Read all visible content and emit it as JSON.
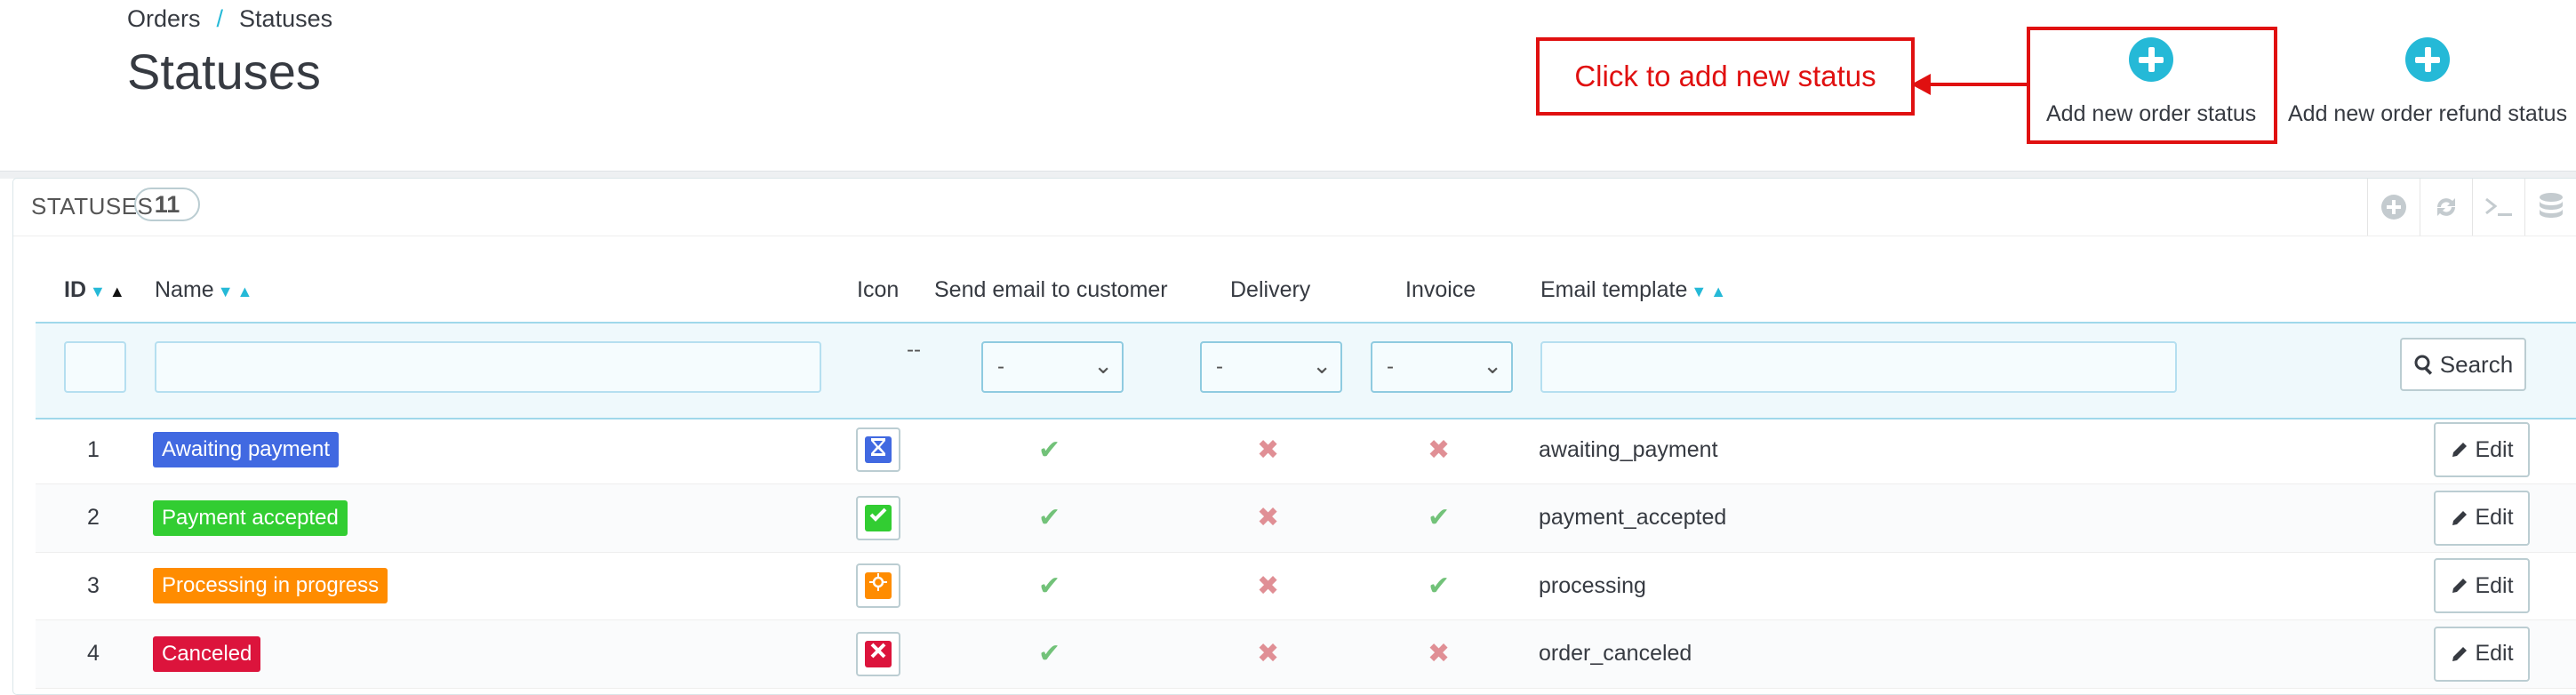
{
  "breadcrumb": {
    "parent": "Orders",
    "separator": "/",
    "current": "Statuses"
  },
  "page_title": "Statuses",
  "callout_text": "Click to add new status",
  "toolbar": {
    "add_order_status": "Add new order status",
    "add_refund_status": "Add new order refund status"
  },
  "panel": {
    "title": "STATUSES",
    "count": "11",
    "heading_icons": [
      "add-icon",
      "refresh-icon",
      "sql-query-icon",
      "database-icon"
    ]
  },
  "table": {
    "columns": {
      "id": "ID",
      "name": "Name",
      "icon": "Icon",
      "send_email": "Send email to customer",
      "delivery": "Delivery",
      "invoice": "Invoice",
      "email_template": "Email template"
    },
    "filters": {
      "icon_placeholder": "--",
      "send_email": "-",
      "delivery": "-",
      "invoice": "-",
      "search_label": "Search"
    },
    "rows": [
      {
        "id": "1",
        "name": "Awaiting payment",
        "color": "#4169e1",
        "icon": "hourglass-icon",
        "send_email": true,
        "delivery": false,
        "invoice": false,
        "template": "awaiting_payment",
        "edit": "Edit"
      },
      {
        "id": "2",
        "name": "Payment accepted",
        "color": "#32cd32",
        "icon": "check-icon",
        "send_email": true,
        "delivery": false,
        "invoice": true,
        "template": "payment_accepted",
        "edit": "Edit"
      },
      {
        "id": "3",
        "name": "Processing in progress",
        "color": "#ff8c00",
        "icon": "gear-icon",
        "send_email": true,
        "delivery": false,
        "invoice": true,
        "template": "processing",
        "edit": "Edit"
      },
      {
        "id": "4",
        "name": "Canceled",
        "color": "#dc143c",
        "icon": "close-icon",
        "send_email": true,
        "delivery": false,
        "invoice": false,
        "template": "order_canceled",
        "edit": "Edit"
      }
    ]
  }
}
